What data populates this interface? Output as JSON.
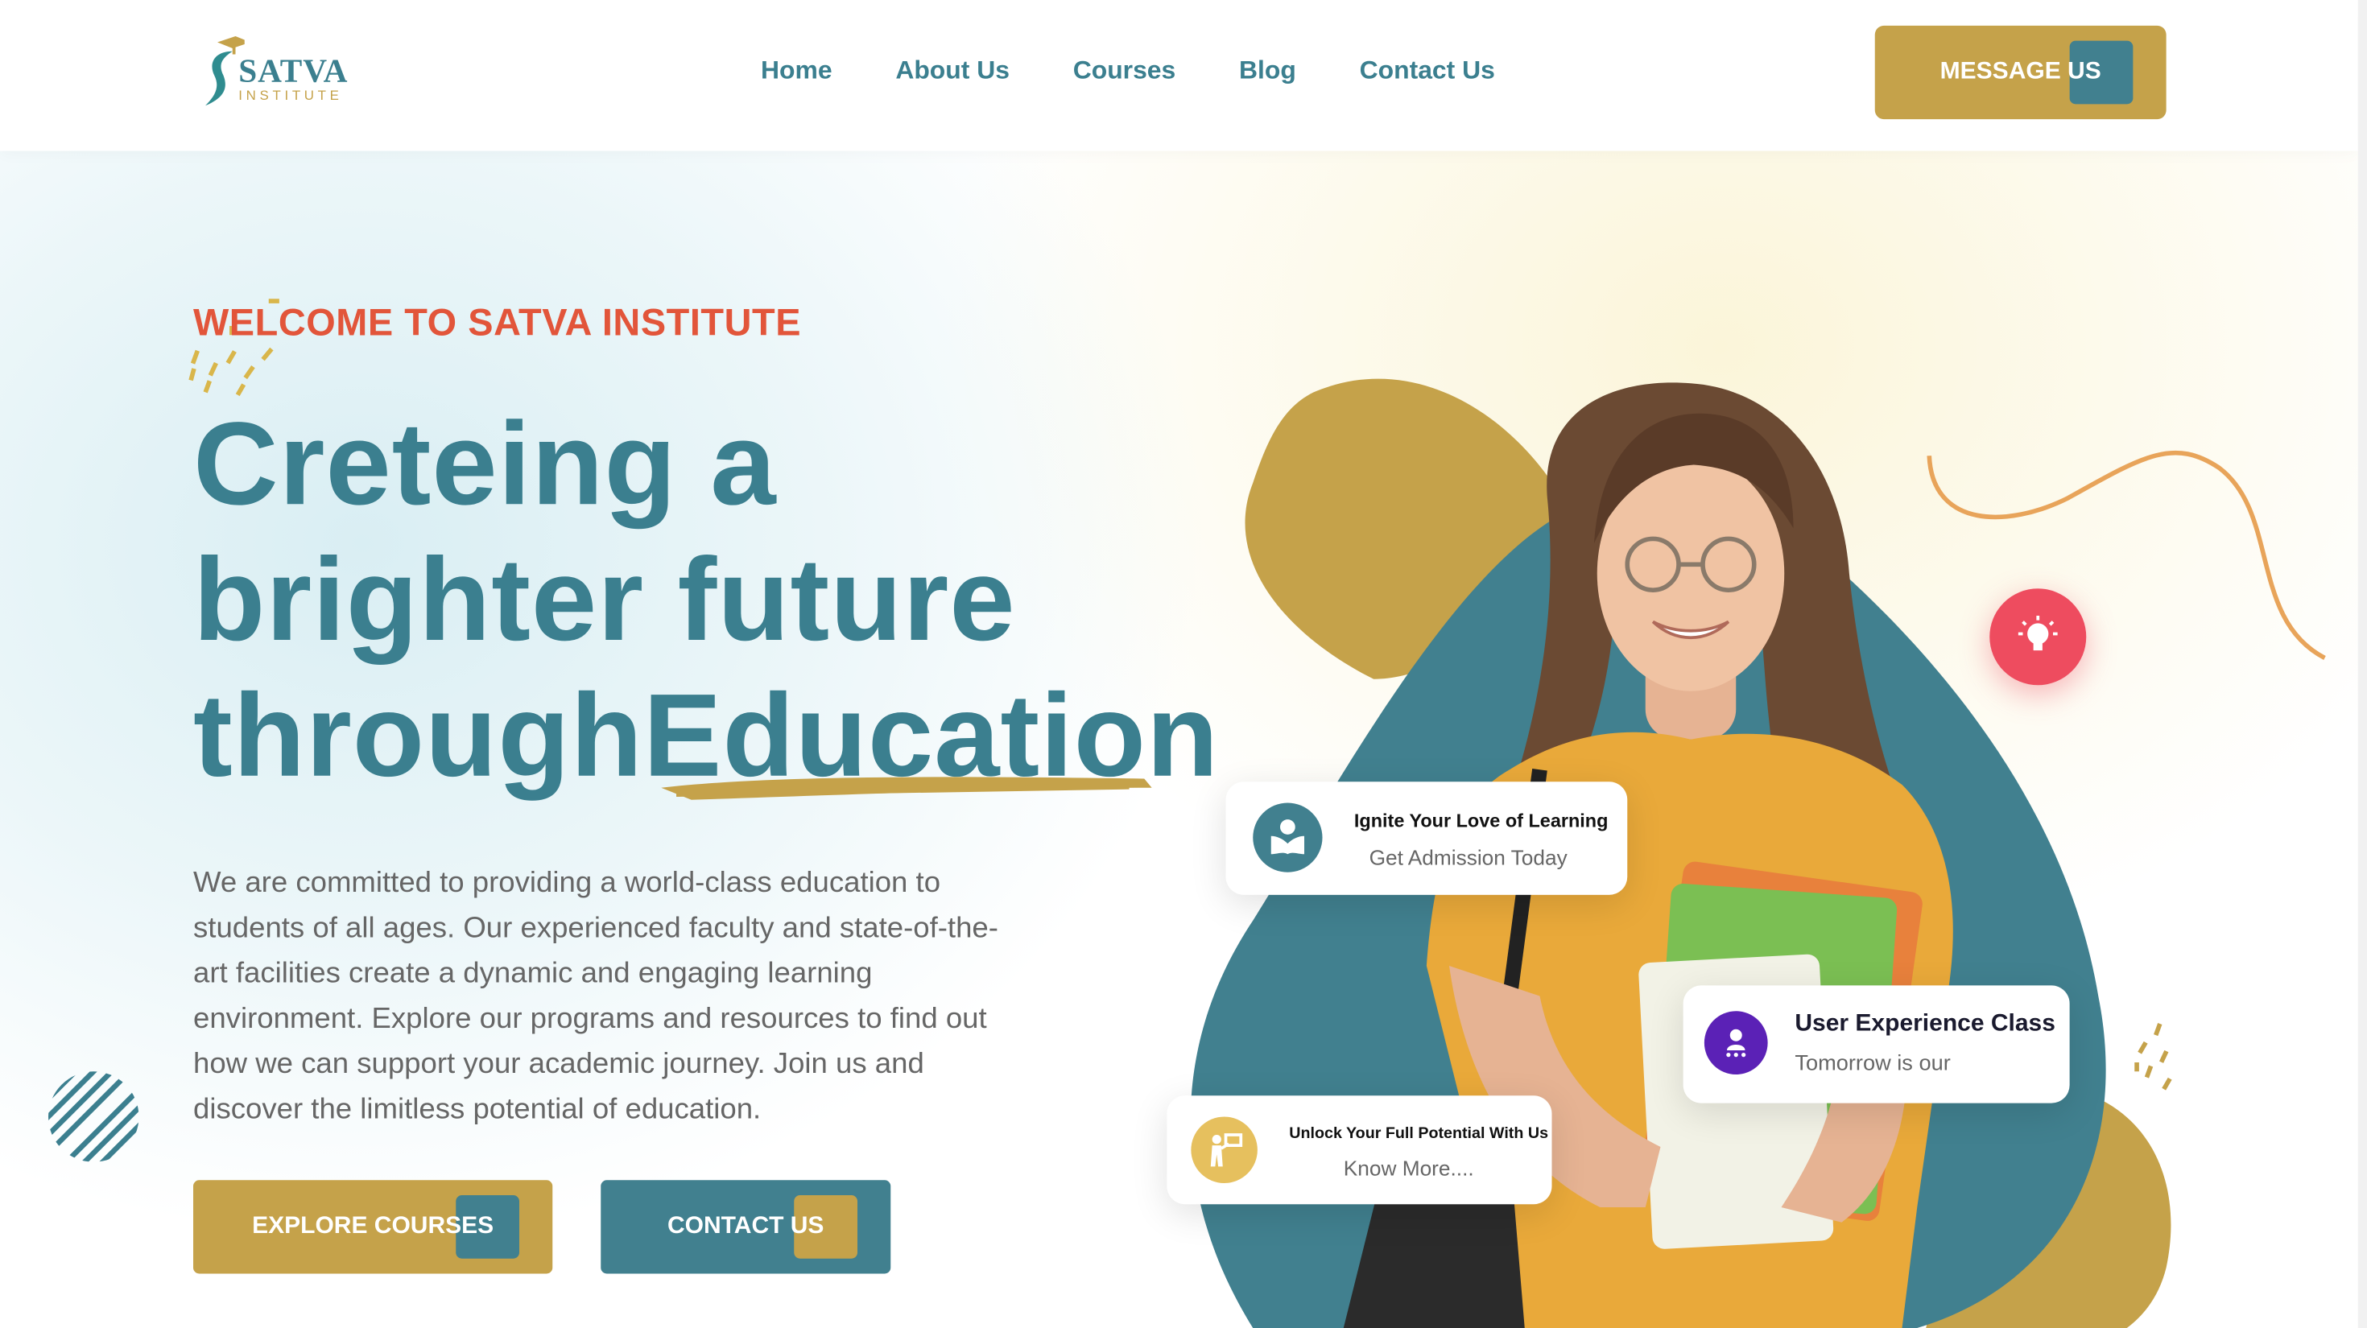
{
  "brand": {
    "name": "SATVA",
    "sub": "INSTITUTE"
  },
  "nav": {
    "items": [
      "Home",
      "About Us",
      "Courses",
      "Blog",
      "Contact Us"
    ]
  },
  "header": {
    "message_button": "MESSAGE US"
  },
  "hero": {
    "welcome": "WELCOME TO SATVA INSTITUTE",
    "headline_line1": "Creteing a",
    "headline_line2": "brighter future",
    "headline_line3": "throughEducation",
    "description": "We are committed to providing a world-class education to students of all ages. Our experienced faculty and state-of-the-art facilities create a dynamic and engaging learning environment. Explore our programs and resources to find out how we can support your academic journey. Join us and discover the limitless potential of education.",
    "explore_button": "EXPLORE COURSES",
    "contact_button": "CONTACT US"
  },
  "cards": {
    "ignite": {
      "title": "Ignite Your Love of Learning",
      "subtitle": "Get Admission Today"
    },
    "ux": {
      "title": "User Experience Class",
      "subtitle": "Tomorrow is our"
    },
    "unlock": {
      "title": "Unlock Your Full Potential With Us",
      "subtitle": "Know More...."
    }
  },
  "colors": {
    "primary": "#3b7f8f",
    "accent": "#c5a24a",
    "highlight": "#e2553a",
    "bulb": "#ee4c5f"
  }
}
